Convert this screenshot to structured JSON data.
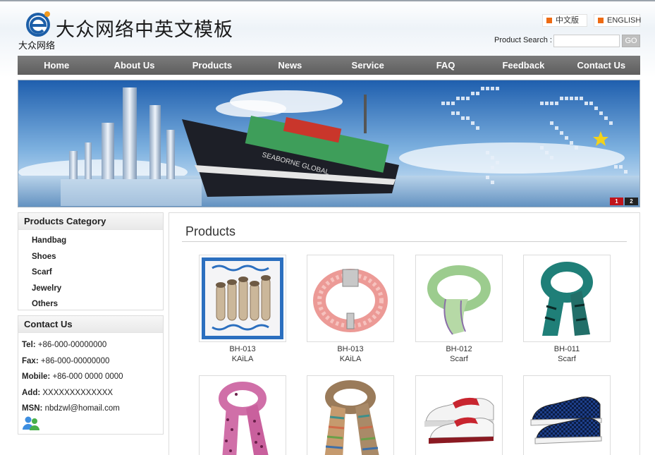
{
  "header": {
    "logo_small_text": "大众网络",
    "logo_title": "大众网络中英文模板",
    "lang_cn": "中文版",
    "lang_en": "ENGLISH",
    "search_label": "Product Search :",
    "search_placeholder": "",
    "search_button": "GO"
  },
  "nav": [
    "Home",
    "About Us",
    "Products",
    "News",
    "Service",
    "FAQ",
    "Feedback",
    "Contact Us"
  ],
  "banner": {
    "ship_name": "SEABORNE GLOBAL",
    "slides": [
      "1",
      "2"
    ],
    "active_slide": "1"
  },
  "sidebar": {
    "category_title": "Products Category",
    "categories": [
      "Handbag",
      "Shoes",
      "Scarf",
      "Jewelry",
      "Others"
    ],
    "contact_title": "Contact Us",
    "contact": {
      "tel_label": "Tel:",
      "tel": " +86-000-00000000",
      "fax_label": "Fax:",
      "fax": " +86-000-00000000",
      "mobile_label": "Mobile:",
      "mobile": " +86-000 0000 0000",
      "add_label": "Add:",
      "add": " XXXXXXXXXXXXX",
      "msn_label": "MSN:",
      "msn": " nbdzwl@homail.com"
    }
  },
  "main": {
    "title": "Products",
    "products": [
      {
        "code": "BH-013",
        "name": "KAiLA",
        "image": "mushroom-plate"
      },
      {
        "code": "BH-013",
        "name": "KAiLA",
        "image": "pink-bracelet"
      },
      {
        "code": "BH-012",
        "name": "Scarf",
        "image": "green-scarf"
      },
      {
        "code": "BH-011",
        "name": "Scarf",
        "image": "teal-scarf"
      },
      {
        "code": "",
        "name": "",
        "image": "pink-dot-scarf"
      },
      {
        "code": "",
        "name": "",
        "image": "striped-scarf"
      },
      {
        "code": "",
        "name": "",
        "image": "red-white-shoe"
      },
      {
        "code": "",
        "name": "",
        "image": "blue-check-shoe"
      }
    ]
  },
  "colors": {
    "nav_bg": "#666666",
    "lang_marker": "#ee6a12",
    "active_dot": "#c1141b"
  }
}
